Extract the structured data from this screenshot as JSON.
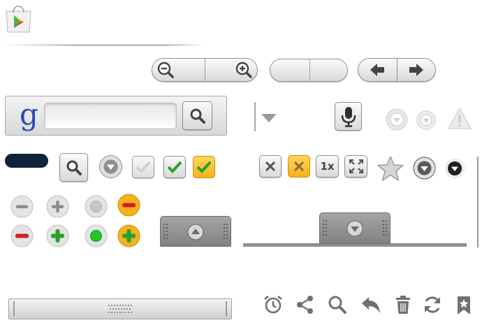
{
  "search": {
    "logo_letter": "g",
    "placeholder": ""
  },
  "speed_buttons": [
    {
      "label": "1x"
    }
  ],
  "icons": {
    "store": "play-store-icon",
    "zoom_out": "zoom-out-icon",
    "zoom_in": "zoom-in-icon",
    "arrow_left": "arrow-left-icon",
    "arrow_right": "arrow-right-icon",
    "search": "search-icon",
    "mic": "microphone-icon",
    "warning": "warning-icon",
    "check": "check-icon",
    "close": "close-icon",
    "fullscreen": "fullscreen-icon",
    "star": "star-icon",
    "alarm": "alarm-icon",
    "share": "share-icon",
    "reply": "reply-icon",
    "delete": "trash-icon",
    "refresh": "refresh-icon",
    "bookmark": "bookmark-icon"
  },
  "colors": {
    "accent_orange": "#f5b21b",
    "green": "#26a12c",
    "red": "#d32020",
    "dark_pill": "#0e223a",
    "handle_gray": "#8d8d8d",
    "icon_gray": "#7a7a7a"
  }
}
